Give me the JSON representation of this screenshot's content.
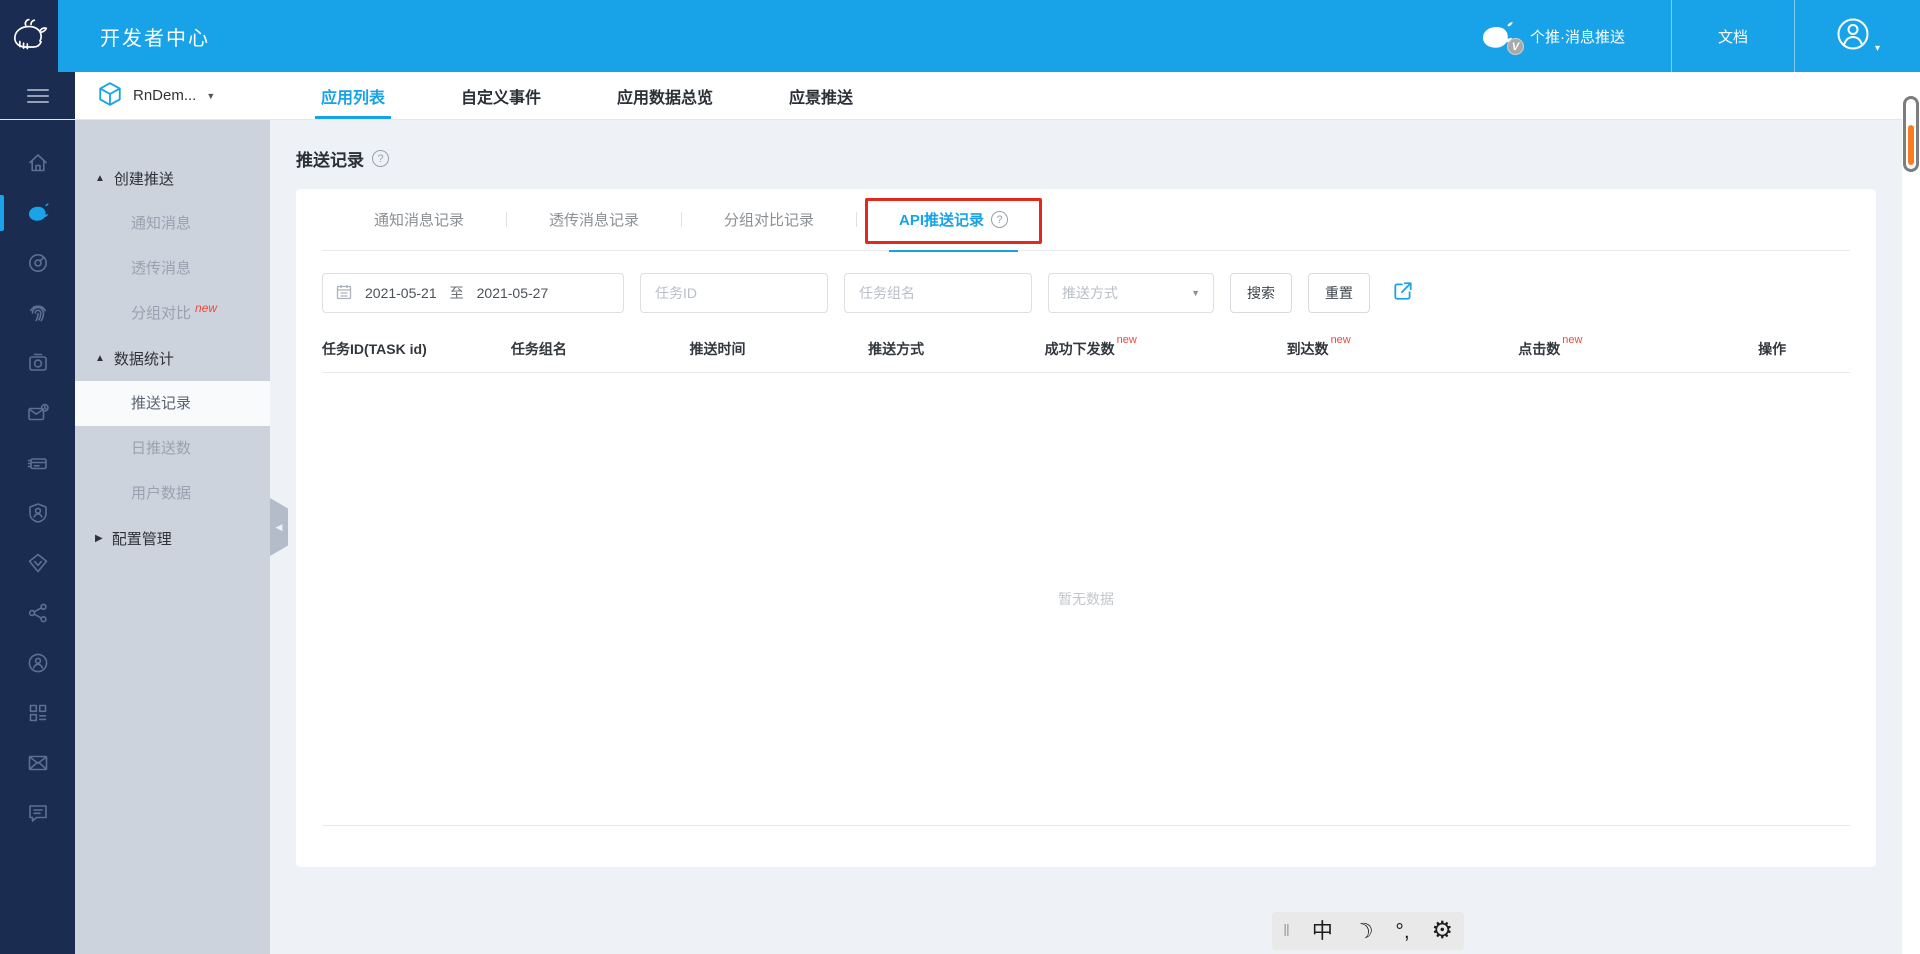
{
  "topbar": {
    "title": "开发者中心",
    "product": "个推·消息推送",
    "v_badge": "V",
    "docs": "文档"
  },
  "appbar": {
    "app_name": "RnDem...",
    "tabs": [
      {
        "label": "应用列表",
        "active": true
      },
      {
        "label": "自定义事件",
        "active": false
      },
      {
        "label": "应用数据总览",
        "active": false
      },
      {
        "label": "应景推送",
        "active": false
      }
    ]
  },
  "sidebar": {
    "rail_icons": [
      "home",
      "push-whale",
      "dashboard-gauge",
      "fingerprint",
      "media-recorder",
      "message-timer",
      "billing",
      "user-shield",
      "vip-diamond",
      "share-network",
      "account-lock",
      "apps-grid",
      "mail",
      "feedback-chat"
    ],
    "sections": [
      {
        "arrow": "▲",
        "label": "创建推送",
        "items": [
          {
            "label": "通知消息"
          },
          {
            "label": "透传消息"
          },
          {
            "label": "分组对比",
            "badge": "new"
          }
        ]
      },
      {
        "arrow": "▲",
        "label": "数据统计",
        "items": [
          {
            "label": "推送记录",
            "active": true
          },
          {
            "label": "日推送数"
          },
          {
            "label": "用户数据"
          }
        ]
      },
      {
        "arrow": "▶",
        "label": "配置管理",
        "items": []
      }
    ]
  },
  "content": {
    "page_title": "推送记录",
    "record_tabs": [
      {
        "label": "通知消息记录",
        "active": false
      },
      {
        "label": "透传消息记录",
        "active": false
      },
      {
        "label": "分组对比记录",
        "active": false
      },
      {
        "label": "API推送记录",
        "active": true,
        "annotated": true
      }
    ],
    "filters": {
      "date_start": "2021-05-21",
      "date_separator": "至",
      "date_end": "2021-05-27",
      "task_id_placeholder": "任务ID",
      "task_group_placeholder": "任务组名",
      "push_type_placeholder": "推送方式",
      "search_label": "搜索",
      "reset_label": "重置"
    },
    "table": {
      "columns": [
        {
          "label": "任务ID(TASK id)"
        },
        {
          "label": "任务组名"
        },
        {
          "label": "推送时间"
        },
        {
          "label": "推送方式"
        },
        {
          "label": "成功下发数",
          "badge": "new"
        },
        {
          "label": "到达数",
          "badge": "new"
        },
        {
          "label": "点击数",
          "badge": "new"
        },
        {
          "label": "操作"
        }
      ],
      "empty_text": "暂无数据"
    }
  },
  "ime_toolbar": {
    "handle": "‖",
    "mode_label": "中",
    "moon": "☽",
    "punctuation_label": "°,",
    "gear": "⚙"
  },
  "glyphs": {
    "question": "?",
    "caret_down": "▼",
    "avatar_caret": "▾",
    "collapse": "◀"
  },
  "colors": {
    "topbar_blue": "#18a3e8",
    "navy": "#1a2c50",
    "accent_blue": "#18a3e8",
    "annotation_red": "#e2291d",
    "new_red": "#f0483e",
    "scroll_orange": "#f97c1f",
    "menu_bg": "#ccd3dd",
    "page_bg": "#eef2f7"
  }
}
